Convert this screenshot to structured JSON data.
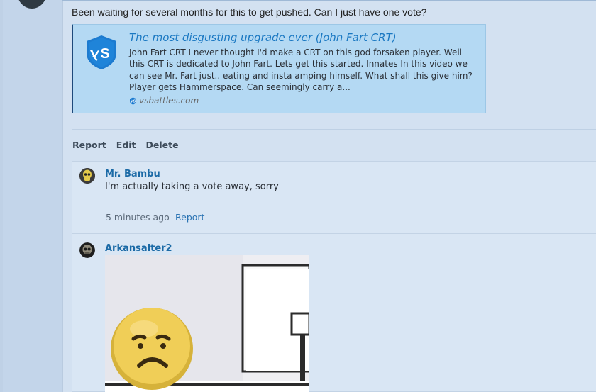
{
  "post": {
    "message": "Been waiting for several months for this to get pushed. Can I just have one vote?",
    "embed": {
      "title": "The most disgusting upgrade ever (John Fart CRT)",
      "description": "John Fart CRT I never thought I'd make a CRT on this god forsaken player. Well this CRT is dedicated to John Fart. Lets get this started. Innates In this video we can see Mr. Fart just.. eating and insta amping himself. What shall this give him? Player gets Hammerspace. Can seemingly carry a...",
      "site": "vsbattles.com",
      "logo_icon": "vs-shield-logo-icon"
    },
    "actions": {
      "report": "Report",
      "edit": "Edit",
      "delete": "Delete"
    }
  },
  "replies": [
    {
      "author": "Mr. Bambu",
      "text": "I'm actually taking a vote away, sorry",
      "time": "5 minutes ago",
      "report": "Report",
      "avatar_icon": "yellow-skull-avatar-icon"
    },
    {
      "author": "Arkansalter2",
      "avatar_icon": "dark-skull-avatar-icon",
      "image": "sad-face-meme-image"
    }
  ],
  "colors": {
    "background": "#d3e1f1",
    "embed_background": "#b4d9f3",
    "link": "#1a78c2",
    "username": "#1b6aa6"
  }
}
